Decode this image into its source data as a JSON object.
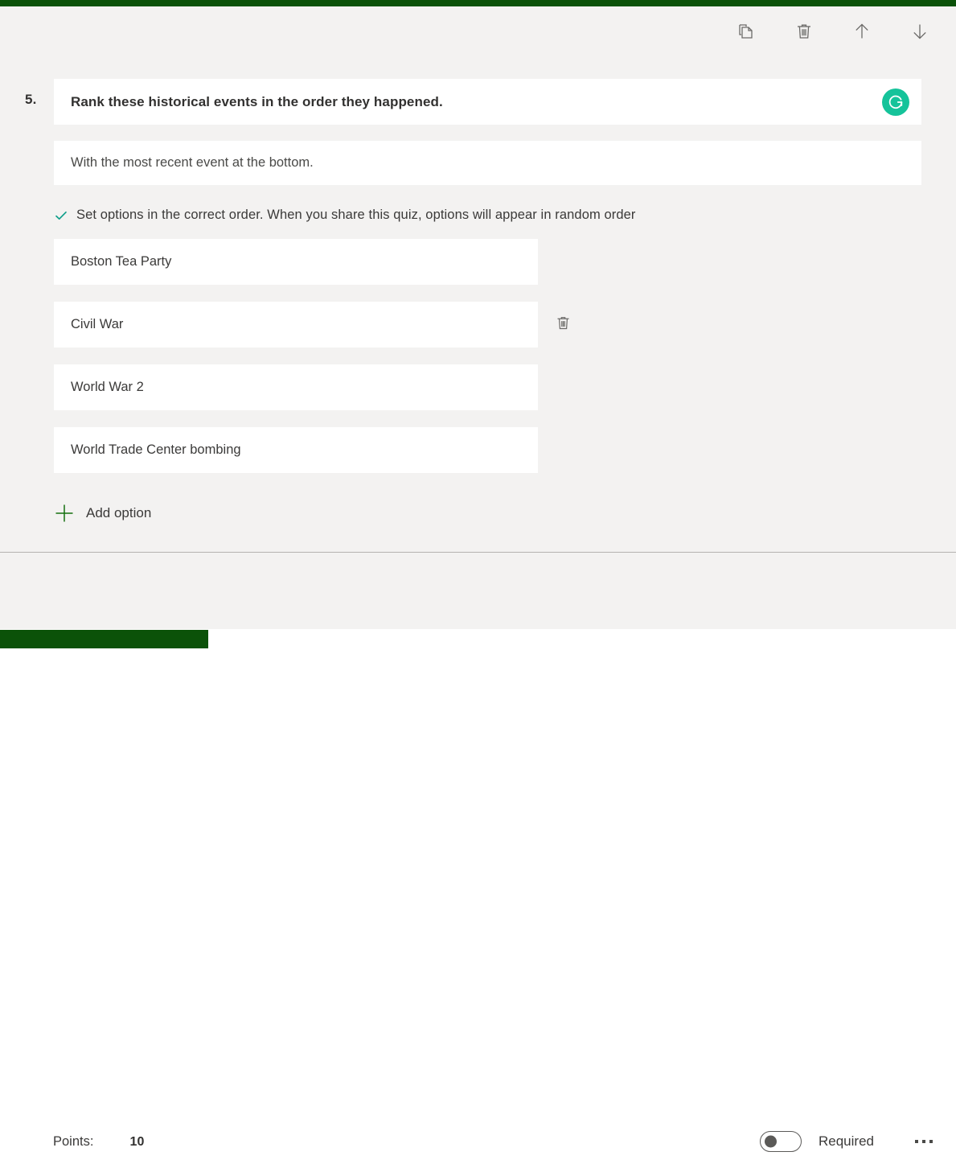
{
  "theme": {
    "accent_green": "#0b5209",
    "page_background": "#f3f2f1",
    "card_background": "#ffffff",
    "grammarly_teal": "#15c39a",
    "check_teal": "#0e9e8a",
    "text_primary": "#323130",
    "text_secondary": "#3b3a39"
  },
  "toolbar": {
    "copy_icon": "copy-icon",
    "delete_icon": "trash-icon",
    "move_up_icon": "arrow-up-icon",
    "move_down_icon": "arrow-down-icon"
  },
  "question": {
    "number": "5.",
    "title": "Rank these historical events in the order they happened.",
    "subtitle": "With the most recent event at the bottom.",
    "assistant_badge": "grammarly-icon",
    "hint": "Set options in the correct order. When you share this quiz, options will appear in random order",
    "hint_icon": "check-icon"
  },
  "options": [
    {
      "text": "Boston Tea Party",
      "has_delete": false
    },
    {
      "text": "Civil War",
      "has_delete": true
    },
    {
      "text": "World War 2",
      "has_delete": false
    },
    {
      "text": "World Trade Center bombing",
      "has_delete": false
    }
  ],
  "add_option": {
    "label": "Add option",
    "icon": "plus-icon"
  },
  "footer": {
    "points_label": "Points:",
    "points_value": "10",
    "required_label": "Required",
    "required_on": false,
    "more_icon": "ellipsis-icon"
  }
}
